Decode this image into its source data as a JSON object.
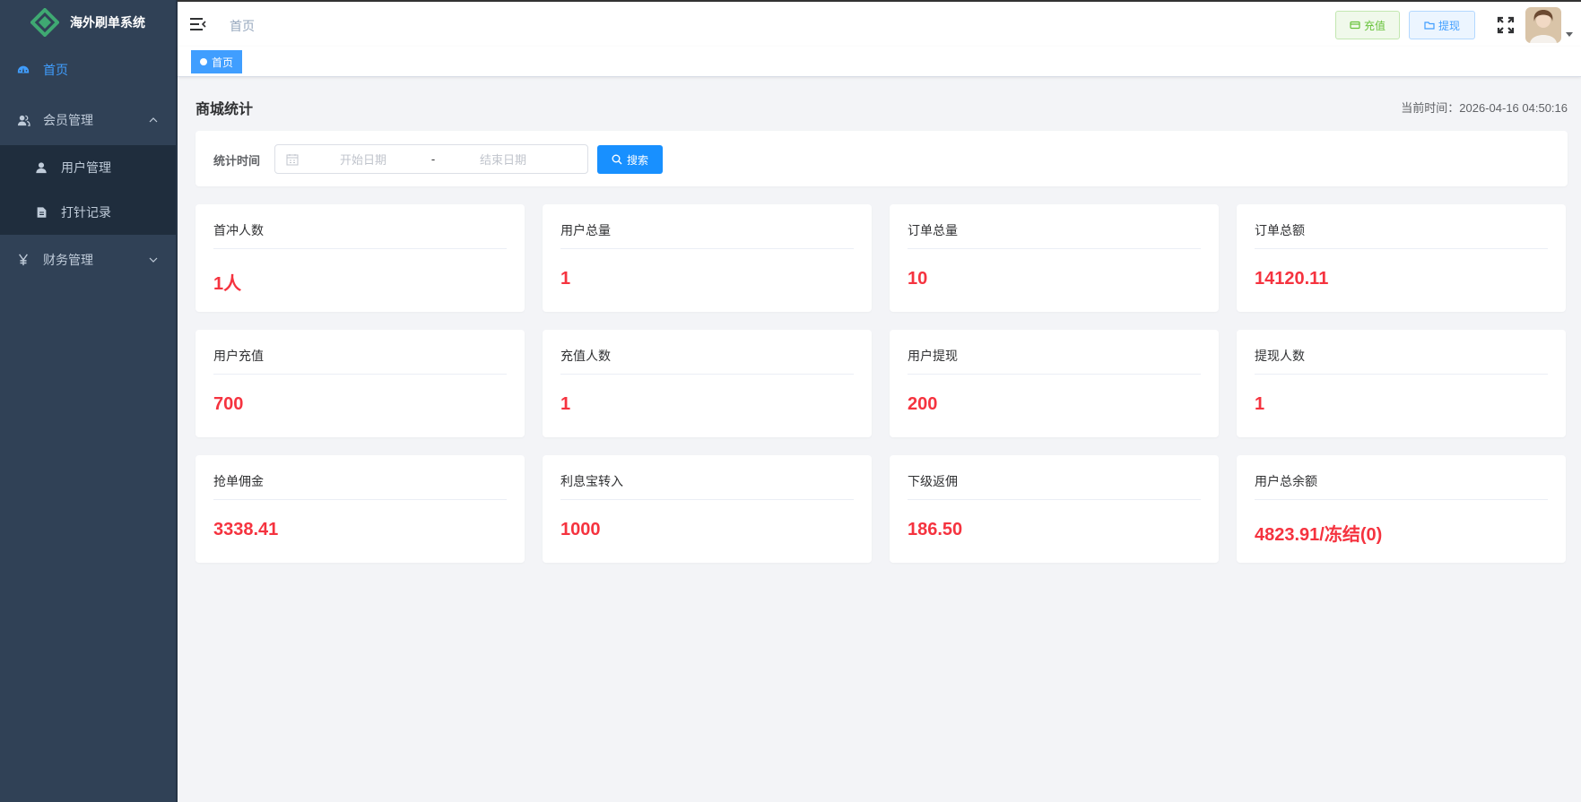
{
  "app": {
    "title": "海外刷单系统"
  },
  "sidebar": {
    "items": [
      {
        "label": "首页",
        "icon": "dashboard-icon",
        "active": true
      },
      {
        "label": "会员管理",
        "icon": "members-icon",
        "expanded": true,
        "children": [
          {
            "label": "用户管理",
            "icon": "user-icon"
          },
          {
            "label": "打针记录",
            "icon": "document-icon"
          }
        ]
      },
      {
        "label": "财务管理",
        "icon": "yen-icon",
        "expanded": false
      }
    ]
  },
  "header": {
    "breadcrumb": "首页",
    "recharge_label": "充值",
    "withdraw_label": "提现"
  },
  "tags": [
    {
      "label": "首页"
    }
  ],
  "page": {
    "title": "商城统计",
    "current_time": "当前时间：2026-04-16 04:50:16"
  },
  "filter": {
    "label": "统计时间",
    "start_placeholder": "开始日期",
    "separator": "-",
    "end_placeholder": "结束日期",
    "search_label": "搜索"
  },
  "stats": [
    {
      "label": "首冲人数",
      "value": "1人"
    },
    {
      "label": "用户总量",
      "value": "1"
    },
    {
      "label": "订单总量",
      "value": "10"
    },
    {
      "label": "订单总额",
      "value": "14120.11"
    },
    {
      "label": "用户充值",
      "value": "700"
    },
    {
      "label": "充值人数",
      "value": "1"
    },
    {
      "label": "用户提现",
      "value": "200"
    },
    {
      "label": "提现人数",
      "value": "1"
    },
    {
      "label": "抢单佣金",
      "value": "3338.41"
    },
    {
      "label": "利息宝转入",
      "value": "1000"
    },
    {
      "label": "下级返佣",
      "value": "186.50"
    },
    {
      "label": "用户总余额",
      "value": "4823.91/冻结(0)"
    }
  ],
  "colors": {
    "sidebar_bg": "#304156",
    "active": "#409eff",
    "value_red": "#f5333f",
    "success": "#67c23a",
    "primary": "#1890ff"
  }
}
